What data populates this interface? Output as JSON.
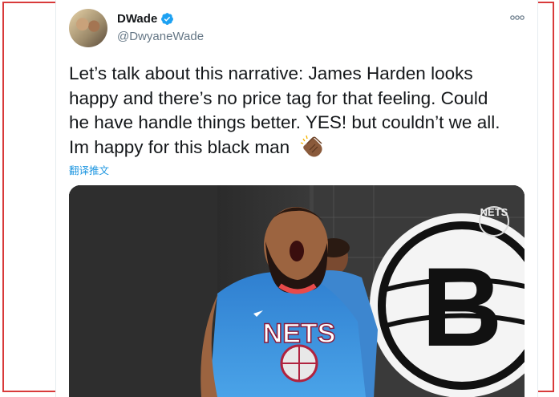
{
  "user": {
    "display_name": "DWade",
    "handle": "@DwyaneWade",
    "verified": true
  },
  "tweet": {
    "text": "Let’s talk about this narrative: James Harden looks\nhappy and there’s no price tag for that feeling. Could\nhe have handle things better. YES! but couldn’t we all.\nIm happy for this black man",
    "emoji": "clapping-hands-medium-dark",
    "translate_link": "翻译推文"
  },
  "media": {
    "jersey_text": "NETS",
    "wall_logo_letter": "B",
    "corner_logo_text": "NETS"
  },
  "colors": {
    "link": "#1b95e0",
    "verified": "#1da1f2",
    "frame": "#d83a3a"
  }
}
